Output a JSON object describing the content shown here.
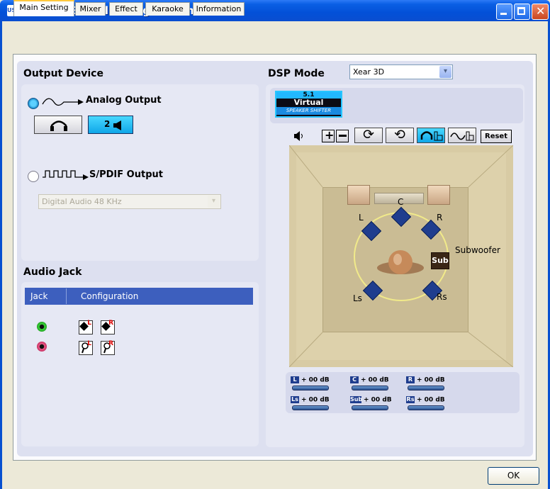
{
  "window": {
    "title": "USB 3D Sound Configuration",
    "app_icon": "USB"
  },
  "tabs": [
    "Main Setting",
    "Mixer",
    "Effect",
    "Karaoke",
    "Information"
  ],
  "output_device": {
    "title": "Output Device",
    "analog_label": "Analog Output",
    "speaker_button_label": "2",
    "spdif_label": "S/PDIF Output",
    "spdif_select_value": "Digital Audio 48 KHz"
  },
  "audio_jack": {
    "title": "Audio Jack",
    "columns": [
      "Jack",
      "Configuration"
    ],
    "cfg_marks": [
      "L",
      "R",
      "L",
      "R"
    ]
  },
  "dsp": {
    "title": "DSP Mode",
    "mode_value": "Xear 3D",
    "badge_top": "5.1",
    "badge_mid": "Virtual",
    "badge_bottom": "SPEAKER SHIFTER",
    "reset_label": "Reset"
  },
  "speakers": {
    "C": "C",
    "L": "L",
    "R": "R",
    "Ls": "Ls",
    "Rs": "Rs",
    "Sub": "Subwoofer",
    "sub_icon": "Sub"
  },
  "gains": [
    {
      "ch": "L",
      "value": "+ 00 dB"
    },
    {
      "ch": "C",
      "value": "+ 00 dB"
    },
    {
      "ch": "R",
      "value": "+ 00 dB"
    },
    {
      "ch": "Ls",
      "value": "+ 00 dB"
    },
    {
      "ch": "Sub",
      "value": "+ 00 dB"
    },
    {
      "ch": "Rs",
      "value": "+ 00 dB"
    }
  ],
  "ok_label": "OK"
}
